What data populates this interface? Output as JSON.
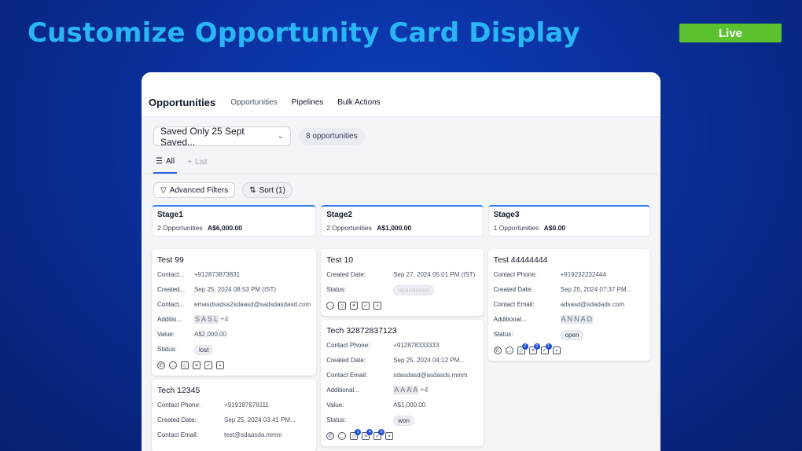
{
  "slide": {
    "title": "Customize Opportunity Card Display",
    "live": "Live"
  },
  "nav": {
    "app_title": "Opportunities",
    "tabs": [
      "Opportunities",
      "Pipelines",
      "Bulk Actions"
    ]
  },
  "filters": {
    "saved_view": "Saved Only 25 Sept Saved...",
    "count": "8 opportunities"
  },
  "views": {
    "all": "All",
    "list": "List"
  },
  "actions": {
    "advanced_filters": "Advanced Filters",
    "sort": "Sort (1)"
  },
  "stages": [
    {
      "name": "Stage1",
      "count": "2 Opportunities",
      "amount": "A$6,000.00"
    },
    {
      "name": "Stage2",
      "count": "2 Opportunities",
      "amount": "A$1,000.00"
    },
    {
      "name": "Stage3",
      "count": "1 Opportunities",
      "amount": "A$0.00"
    }
  ],
  "cards": {
    "c1": {
      "title": "Test 99",
      "rows": [
        {
          "label": "Contact...",
          "value": "+912873873831"
        },
        {
          "label": "Created...",
          "value": "Sep 25, 2024 08:53 PM (IST)"
        },
        {
          "label": "Contact...",
          "value": "emasdsadsa2sdaasd@sadsdasdasd.com"
        },
        {
          "label": "Additio...",
          "value": ""
        },
        {
          "label": "Value:",
          "value": "A$2,000.00"
        },
        {
          "label": "Status:",
          "value": "lost"
        }
      ],
      "avatars": [
        "S",
        "A",
        "S",
        "L"
      ],
      "more": "+4"
    },
    "c2": {
      "title": "Tech 12345",
      "rows": [
        {
          "label": "Contact Phone:",
          "value": "+919187878111"
        },
        {
          "label": "Created Date:",
          "value": "Sep 25, 2024 03:41 PM..."
        },
        {
          "label": "Contact Email:",
          "value": "test@sdaasda.mmm"
        }
      ]
    },
    "c3": {
      "title": "Test 10",
      "rows": [
        {
          "label": "Created Date:",
          "value": "Sep 27, 2024 05:01 PM (IST)"
        },
        {
          "label": "Status:",
          "value": "abandoned"
        }
      ]
    },
    "c4": {
      "title": "Tech 32872837123",
      "rows": [
        {
          "label": "Contact Phone:",
          "value": "+912878333333"
        },
        {
          "label": "Created Date:",
          "value": "Sep 25, 2024 04:12 PM..."
        },
        {
          "label": "Contact Email:",
          "value": "sdasdasd@asdasds.mmm"
        },
        {
          "label": "Additional...",
          "value": ""
        },
        {
          "label": "Value:",
          "value": "A$1,000.00"
        },
        {
          "label": "Status:",
          "value": "won"
        }
      ],
      "avatars": [
        "A",
        "A",
        "A",
        "A"
      ],
      "more": "+4",
      "badges": [
        "1",
        "4",
        "6"
      ]
    },
    "c5": {
      "title": "Test 44444444",
      "rows": [
        {
          "label": "Contact Phone:",
          "value": "+919232232444"
        },
        {
          "label": "Created Date:",
          "value": "Sep 25, 2024 07:37 PM..."
        },
        {
          "label": "Contact Email:",
          "value": "adsasd@sdadads.com"
        },
        {
          "label": "Additional...",
          "value": ""
        },
        {
          "label": "Status:",
          "value": "open"
        }
      ],
      "avatars": [
        "A",
        "N",
        "N",
        "A",
        "D"
      ],
      "badges": [
        "2",
        "2",
        "1"
      ]
    }
  }
}
